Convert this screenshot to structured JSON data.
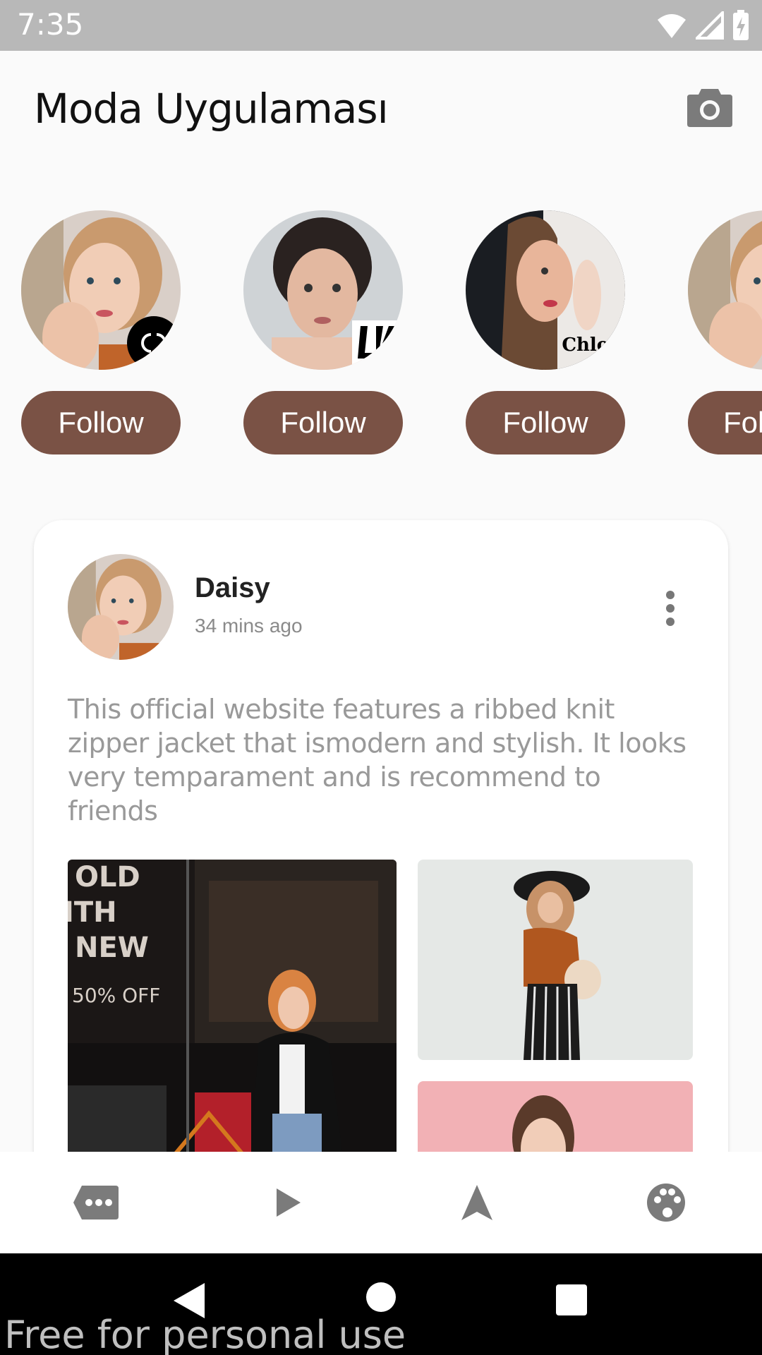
{
  "status_bar": {
    "time": "7:35"
  },
  "app_bar": {
    "title": "Moda Uygulaması",
    "camera_icon": "camera-icon"
  },
  "stories": [
    {
      "brand": "chanel-logo",
      "follow_label": "Follow"
    },
    {
      "brand": "louis-vuitton-logo",
      "follow_label": "Follow"
    },
    {
      "brand": "chloe-logo",
      "brand_text": "Chloé",
      "follow_label": "Follow"
    },
    {
      "brand": "",
      "follow_label": "Follow"
    }
  ],
  "post": {
    "author": "Daisy",
    "time": "34 mins ago",
    "text": "This official website features a ribbed knit zipper jacket that ismodern and stylish. It looks very temparament and is recommend to friends",
    "images": [
      {
        "name": "store-window-photo",
        "overlay_lines": [
          "OLD",
          "ITH",
          "NEW"
        ],
        "offer": "50% OFF"
      },
      {
        "name": "hijab-model-photo"
      },
      {
        "name": "pink-background-portrait"
      }
    ]
  },
  "bottom_nav": [
    "chat-icon",
    "play-icon",
    "navigation-icon",
    "palette-icon"
  ],
  "watermark": "Free for personal use",
  "colors": {
    "accent": "#7a5245",
    "status_bar": "#b8b8b8",
    "background": "#fafafa"
  }
}
